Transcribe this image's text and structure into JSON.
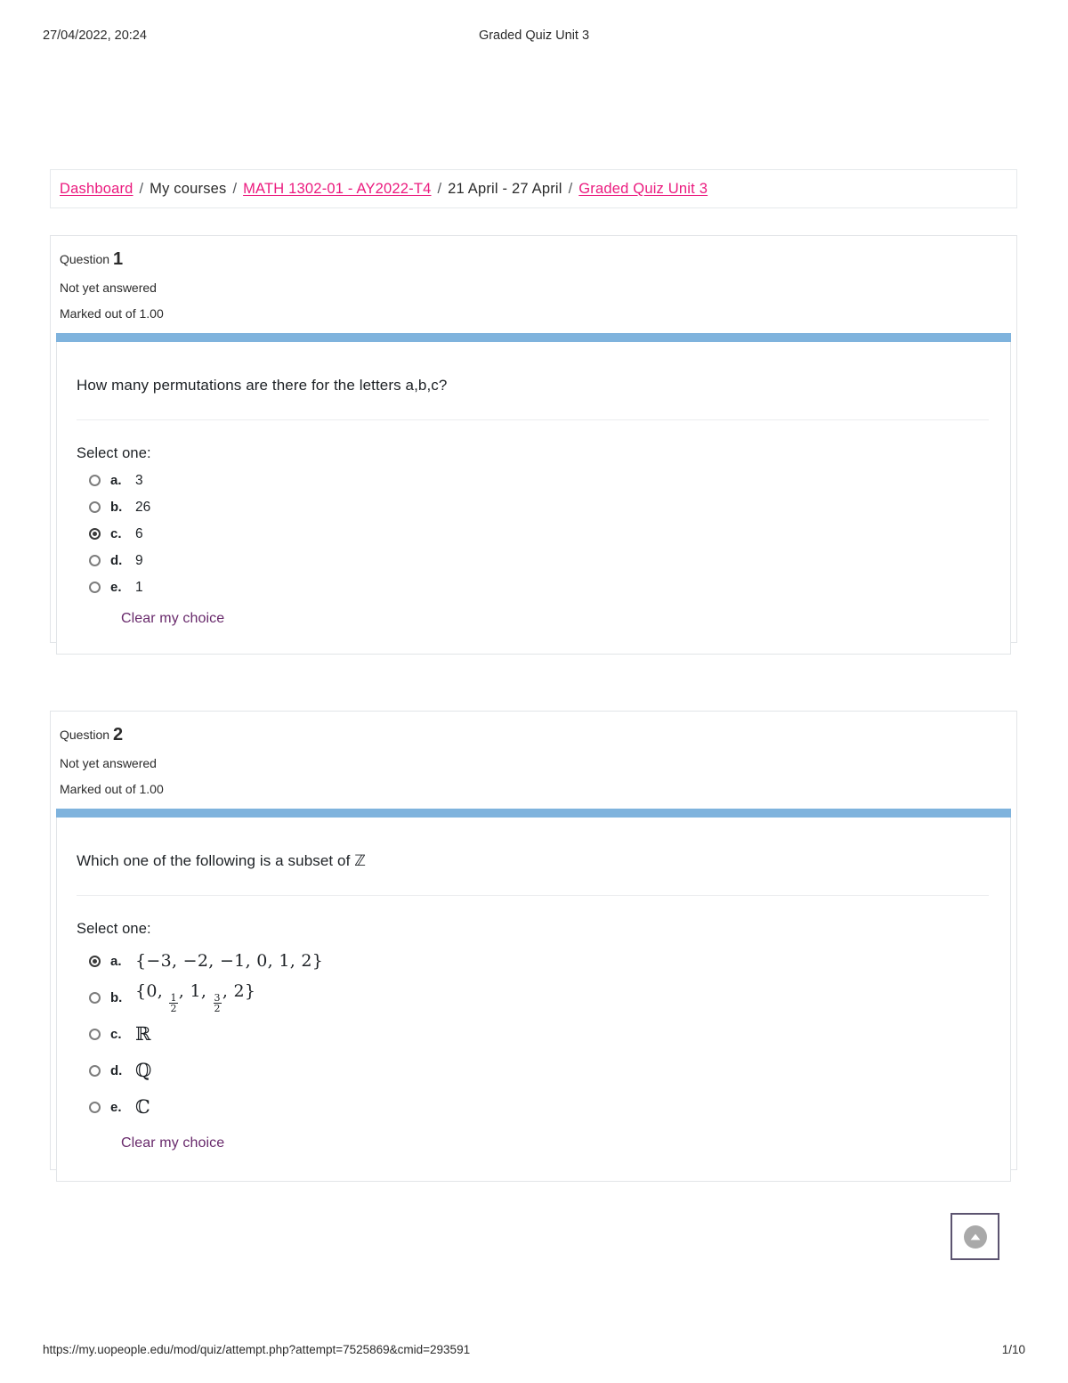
{
  "print_header": {
    "date": "27/04/2022, 20:24",
    "title": "Graded Quiz Unit 3"
  },
  "breadcrumb": {
    "separator": "/",
    "items": [
      {
        "label": "Dashboard",
        "link": true
      },
      {
        "label": "My courses",
        "link": false
      },
      {
        "label": "MATH 1302-01 - AY2022-T4",
        "link": true
      },
      {
        "label": "21 April - 27 April",
        "link": false
      },
      {
        "label": "Graded Quiz Unit 3",
        "link": true
      }
    ]
  },
  "questions": [
    {
      "number_word": "Question",
      "number": "1",
      "state": "Not yet answered",
      "grade": "Marked out of 1.00",
      "text": "How many permutations are there for the letters a,b,c?",
      "select_label": "Select one:",
      "clear_label": "Clear my choice",
      "options": [
        {
          "letter": "a.",
          "text": "3",
          "selected": false
        },
        {
          "letter": "b.",
          "text": "26",
          "selected": false
        },
        {
          "letter": "c.",
          "text": "6",
          "selected": true
        },
        {
          "letter": "d.",
          "text": "9",
          "selected": false
        },
        {
          "letter": "e.",
          "text": "1",
          "selected": false
        }
      ]
    },
    {
      "number_word": "Question",
      "number": "2",
      "state": "Not yet answered",
      "grade": "Marked out of 1.00",
      "text": "Which one of the following is a subset of ℤ",
      "select_label": "Select one:",
      "clear_label": "Clear my choice",
      "options": [
        {
          "letter": "a.",
          "text": "{−3, −2, −1, 0, 1, 2}",
          "selected": true
        },
        {
          "letter": "b.",
          "text": "{0, 1/2, 1, 3/2, 2}",
          "selected": false
        },
        {
          "letter": "c.",
          "text": "ℝ",
          "selected": false
        },
        {
          "letter": "d.",
          "text": "ℚ",
          "selected": false
        },
        {
          "letter": "e.",
          "text": "ℂ",
          "selected": false
        }
      ]
    }
  ],
  "scroll_top": {
    "icon": "chevron-up-icon"
  },
  "print_footer": {
    "url": "https://my.uopeople.edu/mod/quiz/attempt.php?attempt=7525869&cmid=293591",
    "page": "1/10"
  },
  "colors": {
    "link_pink": "#eb1a7e",
    "clear_purple": "#68296b",
    "question_bar_blue": "#7fb3dd",
    "card_border": "#e2e5e8"
  }
}
